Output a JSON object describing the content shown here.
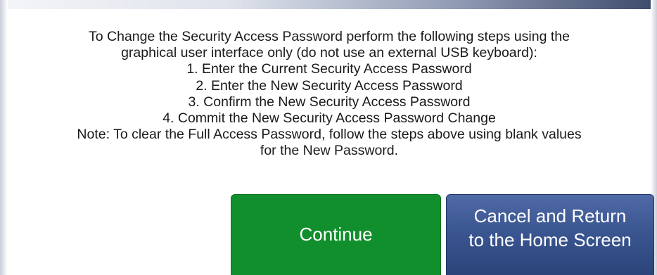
{
  "dialog": {
    "message_lines": [
      "To Change the Security Access Password perform the following steps using the",
      "graphical user interface only (do not use an external USB keyboard):",
      "1. Enter the Current Security Access Password",
      "2. Enter the New Security Access Password",
      "3. Confirm the New Security Access Password",
      "4. Commit the New Security Access Password Change",
      "Note: To clear the Full Access Password, follow the steps above using blank values",
      "for the New Password."
    ]
  },
  "buttons": {
    "continue_label": "Continue",
    "cancel_label_lines": [
      "Cancel and Return",
      "to the Home Screen"
    ]
  },
  "colors": {
    "continue_bg": "#118f2c",
    "cancel_bg": "#3a5590",
    "text": "#1a1a1a"
  }
}
